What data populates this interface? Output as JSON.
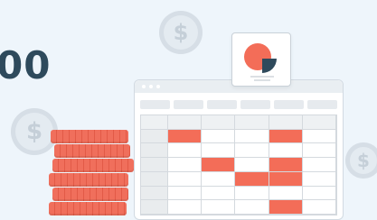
{
  "headline": {
    "text": "00"
  },
  "coins": {
    "symbol": "$"
  },
  "spreadsheet": {
    "rows": 7,
    "cols": 6,
    "highlighted": [
      [
        1,
        1
      ],
      [
        1,
        4
      ],
      [
        3,
        2
      ],
      [
        4,
        3
      ],
      [
        3,
        4
      ],
      [
        4,
        4
      ],
      [
        6,
        4
      ]
    ]
  },
  "colors": {
    "accent": "#f36d58",
    "headline": "#2e4a5c",
    "chart_dark": "#2f4a5c",
    "background": "#eef5fb"
  },
  "icons": [
    "coin-icon",
    "coin-stack-icon",
    "pie-chart-icon"
  ]
}
